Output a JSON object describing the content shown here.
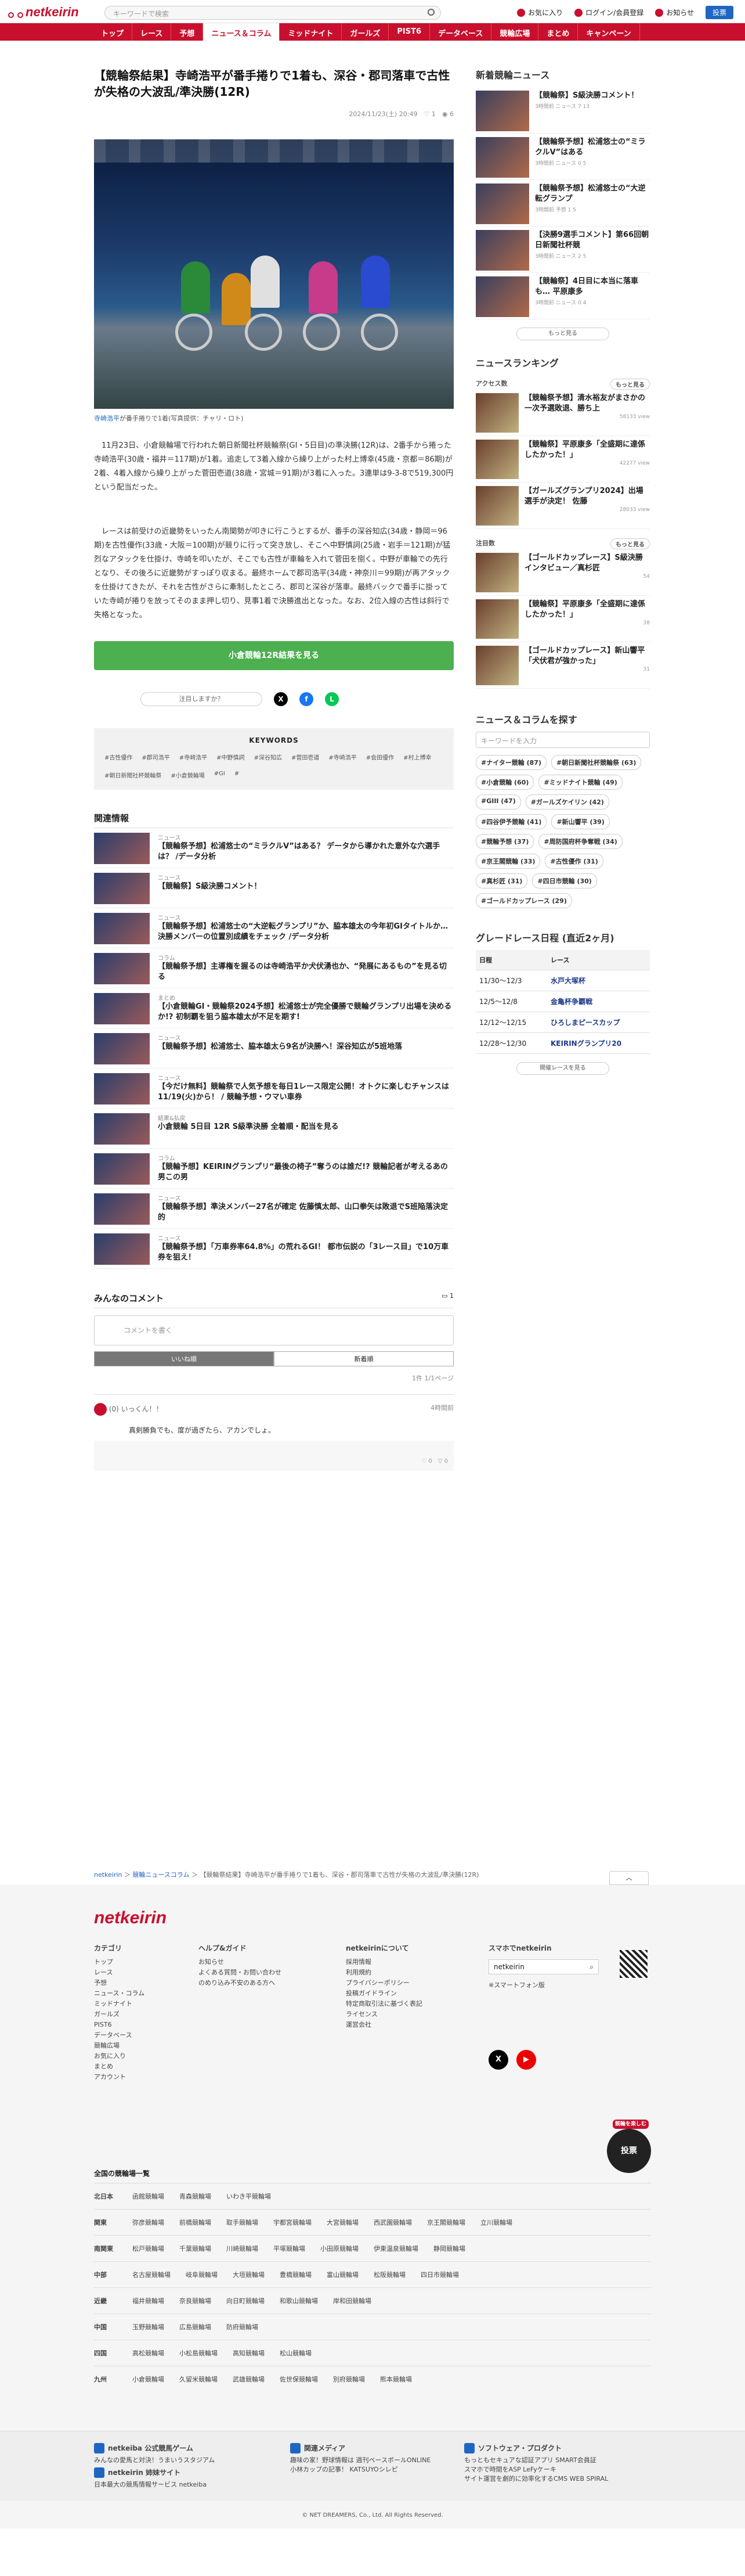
{
  "header": {
    "search_placeholder": "キーワードで検索",
    "fav": "お気に入り",
    "login": "ログイン/会員登録",
    "notify": "お知らせ",
    "pay": "投票"
  },
  "logo": "netkeirin",
  "nav": [
    "トップ",
    "レース",
    "予想",
    "ニュース＆コラム",
    "ミッドナイト",
    "ガールズ",
    "PIST6",
    "データベース",
    "競輪広場",
    "まとめ",
    "キャンペーン"
  ],
  "article": {
    "title": "【競輪祭結果】寺崎浩平が番手捲りで1着も、深谷・郡司落車で古性が失格の大波乱/準決勝(12R)",
    "date": "2024/11/23(土) 20:49",
    "likes": "1",
    "views": "6",
    "caption_name": "寺崎浩平",
    "caption": "が番手捲りで1着(写真提供：チャリ・ロト)",
    "p1": "11月23日、小倉競輪場で行われた朝日新聞社杯競輪祭(GI・5日目)の準決勝(12R)は、2番手から捲った寺崎浩平(30歳・福井＝117期)が1着。追走して3着入線から繰り上がった村上博幸(45歳・京都＝86期)が2着、4着入線から繰り上がった菅田壱道(38歳・宮城＝91期)が3着に入った。3連単は9-3-8で519,300円という配当だった。",
    "p2": "レースは前受けの近畿勢をいったん南関勢が叩きに行こうとするが、番手の深谷知広(34歳・静岡＝96期)を古性優作(33歳・大阪＝100期)が競りに行って突き放し、そこへ中野慎詞(25歳・岩手＝121期)が猛烈なアタックを仕掛け、寺崎を叩いたが、そこでも古性が車輪を入れて菅田を捌く。中野が車輪での先行となり、その後ろに近畿勢がすっぽり収まる。最終ホームで郡司浩平(34歳・神奈川＝99期)が再アタックを仕掛けてきたが、それを古性がさらに牽制したところ、郡司と深谷が落車。最終バックで番手に掛っていた寺崎が捲りを放ってそのまま押し切り、見事1着で決勝進出となった。なお、2位入線の古性は斜行で失格となった。",
    "button": "小倉競輪12R結果を見る",
    "share_pill": "注目しますか？"
  },
  "keywords": {
    "title": "KEYWORDS",
    "items": [
      "#古性優作",
      "#郡司浩平",
      "#寺崎浩平",
      "#中野慎詞",
      "#深谷知広",
      "#菅田壱道",
      "#寺崎浩平",
      "#会田優作",
      "#村上博幸",
      "#朝日新聞社杯競輪祭",
      "#小倉競輪場",
      "#GI",
      "#"
    ]
  },
  "related": {
    "title": "関連情報",
    "items": [
      {
        "cat": "ニュース",
        "title": "【競輪祭予想】松浦悠士の“ミラクルV”はある？ データから導かれた意外な穴選手は？ /データ分析"
      },
      {
        "cat": "ニュース",
        "title": "【競輪祭】S級決勝コメント！"
      },
      {
        "cat": "ニュース",
        "title": "【競輪祭予想】松浦悠士の“大逆転グランプリ”か、脇本雄太の今年初GIタイトルか… 決勝メンバーの位置別成績をチェック /データ分析"
      },
      {
        "cat": "コラム",
        "title": "【競輪祭予想】主導権を握るのは寺崎浩平か犬伏湧也か、“発展にあるもの”を見る切る"
      },
      {
        "cat": "まとめ",
        "title": "【小倉競輪GI・競輪祭2024予想】松浦悠士が完全優勝で競輪グランプリ出場を決めるか!? 初制覇を狙う脇本雄太が不足を期す!"
      },
      {
        "cat": "ニュース",
        "title": "【競輪祭予想】松浦悠士、脇本雄太ら9名が決勝へ！深谷知広が5班地落"
      },
      {
        "cat": "ニュース",
        "title": "【今だけ無料】競輪祭で人気予想を毎日1レース限定公開！オトクに楽しむチャンスは11/19(火)から！ / 競輪予想・ウマい車券"
      },
      {
        "cat": "結果&払戻",
        "title": "小倉競輪 5日目 12R S級準決勝 全着順・配当を見る"
      },
      {
        "cat": "コラム",
        "title": "【競輪予想】KEIRINグランプリ“最後の椅子”奪うのは誰だ!? 競輪記者が考えるあの男この男"
      },
      {
        "cat": "ニュース",
        "title": "【競輪祭予想】準決メンバー27名が確定 佐藤慎太郎、山口拳矢は敗退でS班陥落決定的"
      },
      {
        "cat": "ニュース",
        "title": "【競輪祭予想】「万車券率64.8%」の荒れるGI！ 都市伝説の「3レース目」で10万車券を狙え！"
      }
    ]
  },
  "comments": {
    "title": "みんなのコメント",
    "count": "1",
    "placeholder": "コメントを書く",
    "tab_good": "いいね順",
    "tab_new": "新着順",
    "paging": "1件 1/1ページ",
    "user": "(0) いっくん！！",
    "time": "4時間前",
    "text": "真剣勝負でも、度が過ぎたら、アカンでしょ。",
    "like": "0",
    "bad": "0"
  },
  "sidebar": {
    "news_title": "新着競輪ニュース",
    "news": [
      {
        "title": "【競輪祭】S級決勝コメント！",
        "meta": "3時間前 ニュース 7 13"
      },
      {
        "title": "【競輪祭予想】松浦悠士の“ミラクルV”はある",
        "meta": "3時間前 ニュース 0 5"
      },
      {
        "title": "【競輪祭予想】松浦悠士の“大逆転グランプ",
        "meta": "3時間前 予想 1 5"
      },
      {
        "title": "【決勝9選手コメント】第66回朝日新聞社杯競",
        "meta": "3時間前 ニュース 2 5"
      },
      {
        "title": "【競輪祭】4日目に本当に落車も… 平原康多",
        "meta": "3時間前 ニュース 0 4"
      }
    ],
    "more": "もっと見る",
    "rank_title": "ニュースランキング",
    "access_label": "アクセス数",
    "access": [
      {
        "title": "【競輪祭予想】清水裕友がまさかの一次予選敗退、勝ち上",
        "v": "58133 view"
      },
      {
        "title": "【競輪祭】平原康多「全盛期に達係したかった！」",
        "v": "42277 view"
      },
      {
        "title": "【ガールズグランプリ2024】出場選手が決定！ 佐藤",
        "v": "28033 view"
      }
    ],
    "attention_label": "注目数",
    "attention": [
      {
        "title": "【ゴールドカップレース】S級決勝インタビュー／真杉匠",
        "v": "54"
      },
      {
        "title": "【競輪祭】平原康多「全盛期に達係したかった！」",
        "v": "38"
      },
      {
        "title": "【ゴールドカップレース】新山響平「犬伏君が強かった」",
        "v": "31"
      }
    ],
    "search_title": "ニュース＆コラムを探す",
    "search_placeholder": "キーワードを入力",
    "tags": [
      "#ナイター競輪 (87)",
      "#朝日新聞社杯競輪祭 (63)",
      "#小倉競輪 (60)",
      "#ミッドナイト競輪 (49)",
      "#GIII (47)",
      "#ガールズケイリン (42)",
      "#四谷伊予競輪 (41)",
      "#新山響平 (39)",
      "#競輪予想 (37)",
      "#周防国府杯争奪戦 (34)",
      "#京王閣競輪 (33)",
      "#古性優作 (31)",
      "#真杉匠 (31)",
      "#四日市競輪 (30)",
      "#ゴールドカップレース (29)"
    ],
    "grade_title": "グレードレース日程 (直近2ヶ月)",
    "grade_head": [
      "日程",
      "レース"
    ],
    "grades": [
      [
        "11/30〜12/3",
        "水戸大塚杯"
      ],
      [
        "12/5〜12/8",
        "金亀杯争覇戦"
      ],
      [
        "12/12〜12/15",
        "ひろしまピースカップ"
      ],
      [
        "12/28〜12/30",
        "KEIRINグランプリ20"
      ]
    ],
    "grade_more": "開催レースを見る"
  },
  "breadcrumb": [
    "netkeirin",
    "競輪ニュースコラム",
    "【競輪祭結果】寺崎浩平が番手捲りで1着も、深谷・郡司落車で古性が失格の大波乱/準決勝(12R)"
  ],
  "footer": {
    "logo": "netkeirin",
    "cat_title": "カテゴリ",
    "cats": [
      "トップ",
      "レース",
      "予想",
      "ニュース・コラム",
      "ミッドナイト",
      "ガールズ",
      "PIST6",
      "データベース",
      "競輪広場",
      "お気に入り",
      "まとめ",
      "アカウント"
    ],
    "help_title": "ヘルプ&ガイド",
    "help": [
      "お知らせ",
      "よくある質問・お問い合わせ",
      "のめり込み不安のある方へ"
    ],
    "about_title": "netkeirinについて",
    "about": [
      "採用情報",
      "利用規約",
      "プライバシーポリシー",
      "投稿ガイドライン",
      "特定商取引法に基づく表記",
      "ライセンス",
      "運営会社"
    ],
    "app_title": "スマホでnetkeirin",
    "app_search": "netkeirin",
    "app_note": "※スマートフォン版",
    "fab_badge": "競輪を楽しむ",
    "fab": "投票",
    "venue_title": "全国の競輪場一覧",
    "venues": [
      {
        "region": "北日本",
        "list": [
          "函館競輪場",
          "青森競輪場",
          "いわき平競輪場"
        ]
      },
      {
        "region": "関東",
        "list": [
          "弥彦競輪場",
          "前橋競輪場",
          "取手競輪場",
          "宇都宮競輪場",
          "大宮競輪場",
          "西武園競輪場",
          "京王閣競輪場",
          "立川競輪場"
        ]
      },
      {
        "region": "南関東",
        "list": [
          "松戸競輪場",
          "千葉競輪場",
          "川崎競輪場",
          "平塚競輪場",
          "小田原競輪場",
          "伊東温泉競輪場",
          "静岡競輪場"
        ]
      },
      {
        "region": "中部",
        "list": [
          "名古屋競輪場",
          "岐阜競輪場",
          "大垣競輪場",
          "豊橋競輪場",
          "富山競輪場",
          "松阪競輪場",
          "四日市競輪場"
        ]
      },
      {
        "region": "近畿",
        "list": [
          "福井競輪場",
          "奈良競輪場",
          "向日町競輪場",
          "和歌山競輪場",
          "岸和田競輪場"
        ]
      },
      {
        "region": "中国",
        "list": [
          "玉野競輪場",
          "広島競輪場",
          "防府競輪場"
        ]
      },
      {
        "region": "四国",
        "list": [
          "高松競輪場",
          "小松島競輪場",
          "高知競輪場",
          "松山競輪場"
        ]
      },
      {
        "region": "九州",
        "list": [
          "小倉競輪場",
          "久留米競輪場",
          "武雄競輪場",
          "佐世保競輪場",
          "別府競輪場",
          "熊本競輪場"
        ]
      }
    ],
    "svc": [
      {
        "title": "netkeiba 公式競馬ゲーム",
        "items": [
          "みんなの愛馬と対決！うまいうスタジアム"
        ]
      },
      {
        "title": "関連メディア",
        "items": [
          "趣味の家！野球情報は 週刊ベースボールONLINE",
          "小林カップの記事！ KATSUYOシレピ"
        ]
      },
      {
        "title": "ソフトウェア・プロダクト",
        "items": [
          "もっともセキュアな認証アプリ SMART会員証",
          "スマホで時間をASP LeFyケーキ",
          "サイト運営を劇的に効率化するCMS WEB SPIRAL"
        ]
      },
      {
        "title": "netkeirin 姉妹サイト",
        "items": [
          "日本最大の競馬情報サービス netkeiba"
        ]
      }
    ],
    "copyright": "© NET DREAMERS, Co., Ltd. All Rights Reserved."
  },
  "colors": {
    "brand": "#c8102e",
    "link": "#1f66c2",
    "button": "#4caf50"
  }
}
